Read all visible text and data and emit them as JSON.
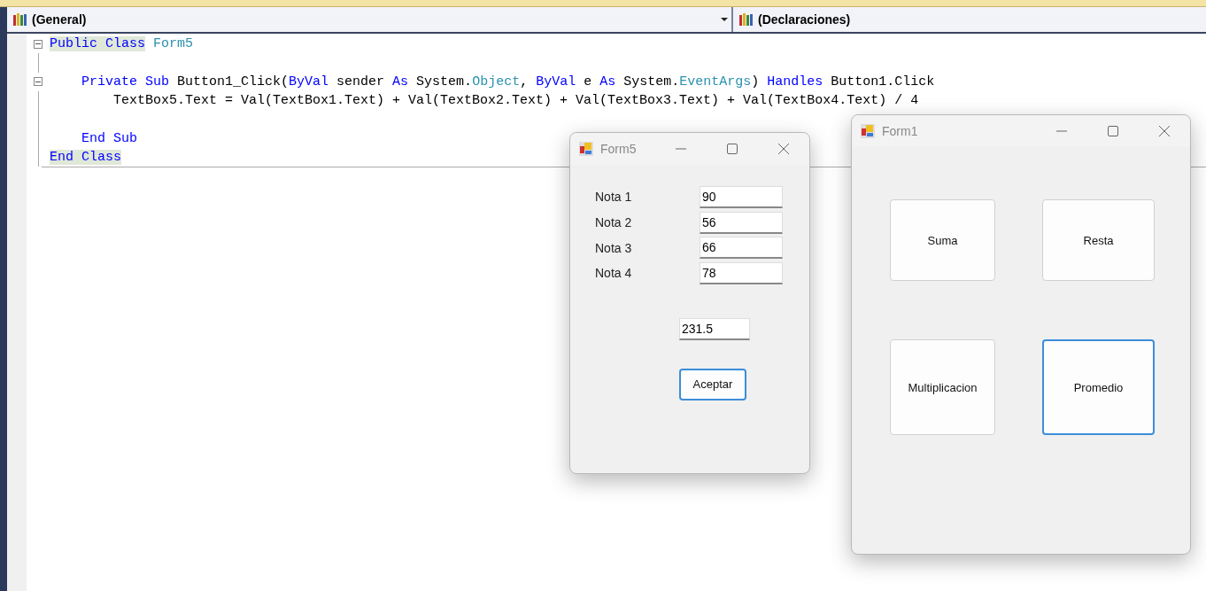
{
  "combos": [
    {
      "label": "(General)",
      "dropdown": true
    },
    {
      "label": "(Declaraciones)"
    }
  ],
  "code": [
    {
      "kind": "code",
      "foldable": true,
      "segments": [
        {
          "text": "Public Class",
          "kind": "keyword",
          "highlighted": true
        },
        {
          "text": " Form5",
          "kind": "type"
        }
      ],
      "children": [
        {
          "kind": "blank"
        },
        {
          "kind": "code",
          "foldable": true,
          "segments": [
            {
              "text": "Private Sub",
              "kind": "keyword"
            },
            {
              "text": " Button1_Click(",
              "kind": "plain"
            },
            {
              "text": "ByVal",
              "kind": "keyword"
            },
            {
              "text": " sender ",
              "kind": "plain"
            },
            {
              "text": "As",
              "kind": "keyword"
            },
            {
              "text": " System.",
              "kind": "plain"
            },
            {
              "text": "Object",
              "kind": "type"
            },
            {
              "text": ", ",
              "kind": "plain"
            },
            {
              "text": "ByVal",
              "kind": "keyword"
            },
            {
              "text": " e ",
              "kind": "plain"
            },
            {
              "text": "As",
              "kind": "keyword"
            },
            {
              "text": " System.",
              "kind": "plain"
            },
            {
              "text": "EventArgs",
              "kind": "type"
            },
            {
              "text": ") ",
              "kind": "plain"
            },
            {
              "text": "Handles",
              "kind": "keyword"
            },
            {
              "text": " Button1.Click",
              "kind": "plain"
            }
          ],
          "children": [
            {
              "kind": "code",
              "segments": [
                {
                  "text": "TextBox5.Text = Val(TextBox1.Text) + Val(TextBox2.Text) + Val(TextBox3.Text) + Val(TextBox4.Text) / 4",
                  "kind": "plain"
                }
              ]
            },
            {
              "kind": "blank"
            }
          ]
        },
        {
          "kind": "code",
          "segments": [
            {
              "text": "End Sub",
              "kind": "keyword"
            }
          ]
        }
      ]
    },
    {
      "kind": "code",
      "segments": [
        {
          "text": "End Class",
          "kind": "keyword",
          "highlighted": true
        }
      ]
    }
  ],
  "form5": {
    "title": "Form5",
    "fields": [
      {
        "label": "Nota 1",
        "value": "90"
      },
      {
        "label": "Nota 2",
        "value": "56"
      },
      {
        "label": "Nota 3",
        "value": "66"
      },
      {
        "label": "Nota 4",
        "value": "78"
      }
    ],
    "result": "231.5",
    "button": {
      "label": "Aceptar",
      "focused": true
    }
  },
  "form1": {
    "title": "Form1",
    "buttons": [
      {
        "label": "Suma",
        "focused": false
      },
      {
        "label": "Resta",
        "focused": false
      },
      {
        "label": "Multiplicacion",
        "focused": false
      },
      {
        "label": "Promedio",
        "focused": true
      }
    ]
  }
}
